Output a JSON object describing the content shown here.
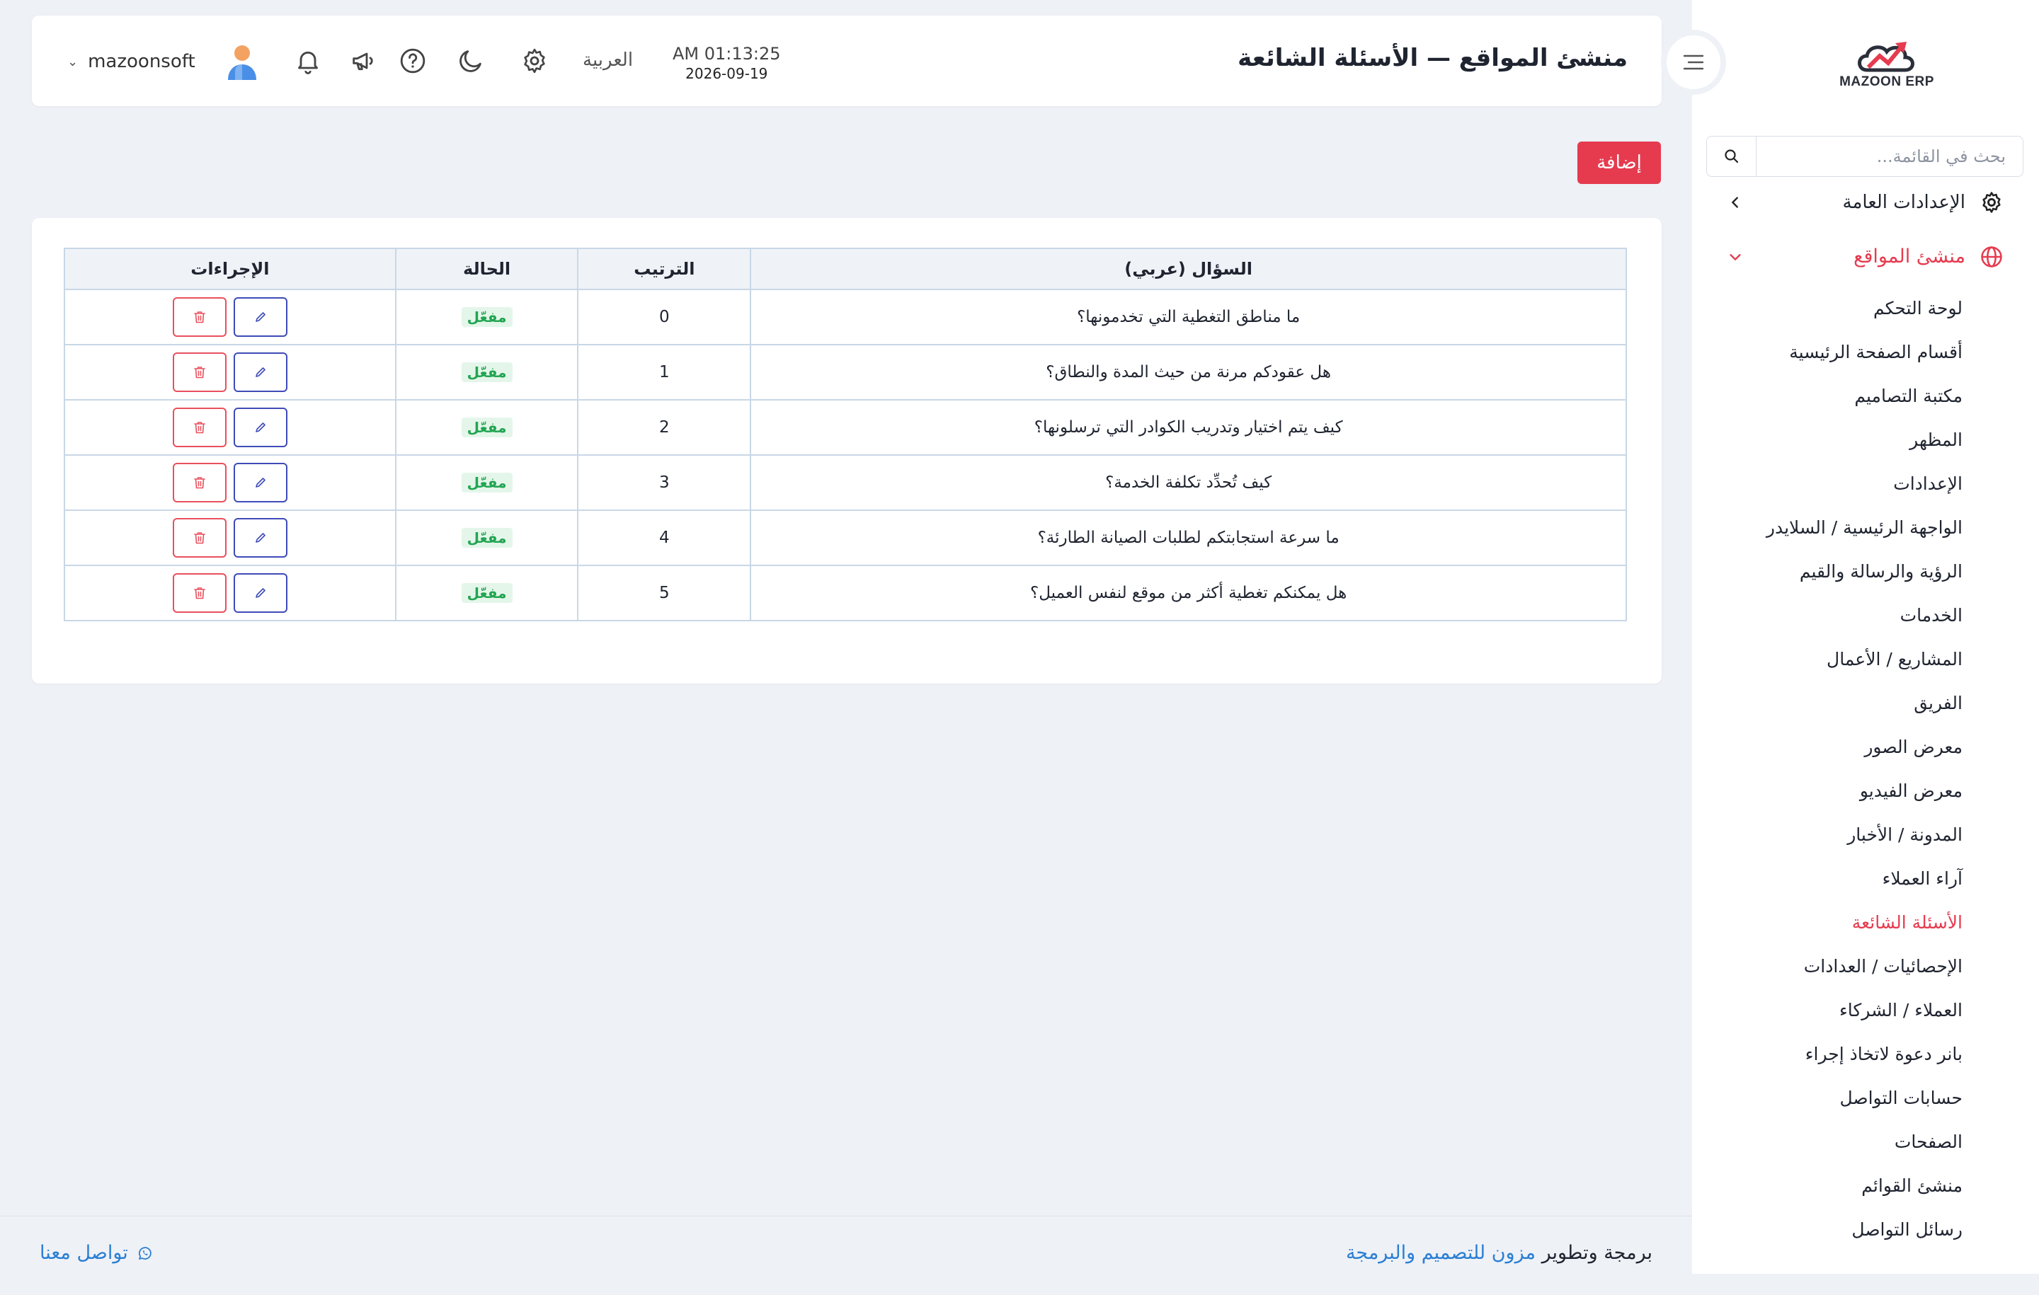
{
  "app": {
    "logo_text": "MAZOON ERP"
  },
  "header": {
    "title": "منشئ المواقع — الأسئلة الشائعة",
    "time": "AM 01:13:25",
    "date": "2026-09-19",
    "language": "العربية",
    "username": "mazoonsoft"
  },
  "sidebar": {
    "search_placeholder": "بحث في القائمة...",
    "general_settings": "الإعدادات العامة",
    "group_label": "منشئ المواقع",
    "items": [
      "لوحة التحكم",
      "أقسام الصفحة الرئيسية",
      "مكتبة التصاميم",
      "المظهر",
      "الإعدادات",
      "الواجهة الرئيسية / السلايدر",
      "الرؤية والرسالة والقيم",
      "الخدمات",
      "المشاريع / الأعمال",
      "الفريق",
      "معرض الصور",
      "معرض الفيديو",
      "المدونة / الأخبار",
      "آراء العملاء",
      "الأسئلة الشائعة",
      "الإحصائيات / العدادات",
      "العملاء / الشركاء",
      "بانر دعوة لاتخاذ إجراء",
      "حسابات التواصل",
      "الصفحات",
      "منشئ القوائم",
      "رسائل التواصل"
    ],
    "active_item": "الأسئلة الشائعة"
  },
  "toolbar": {
    "add_label": "إضافة"
  },
  "table": {
    "headers": {
      "question": "السؤال (عربي)",
      "order": "الترتيب",
      "status": "الحالة",
      "actions": "الإجراءات"
    },
    "rows": [
      {
        "question": "ما مناطق التغطية التي تخدمونها؟",
        "order": "0",
        "status": "مفعّل"
      },
      {
        "question": "هل عقودكم مرنة من حيث المدة والنطاق؟",
        "order": "1",
        "status": "مفعّل"
      },
      {
        "question": "كيف يتم اختيار وتدريب الكوادر التي ترسلونها؟",
        "order": "2",
        "status": "مفعّل"
      },
      {
        "question": "كيف تُحدِّد تكلفة الخدمة؟",
        "order": "3",
        "status": "مفعّل"
      },
      {
        "question": "ما سرعة استجابتكم لطلبات الصيانة الطارئة؟",
        "order": "4",
        "status": "مفعّل"
      },
      {
        "question": "هل يمكنكم تغطية أكثر من موقع لنفس العميل؟",
        "order": "5",
        "status": "مفعّل"
      }
    ]
  },
  "footer": {
    "credit_prefix": "برمجة وتطوير",
    "credit_link": "مزون للتصميم والبرمجة",
    "contact_label": "تواصل معنا"
  },
  "colors": {
    "accent": "#e63b4f",
    "link": "#2a7fd4",
    "success": "#22a552",
    "edit": "#3e4bb8"
  }
}
